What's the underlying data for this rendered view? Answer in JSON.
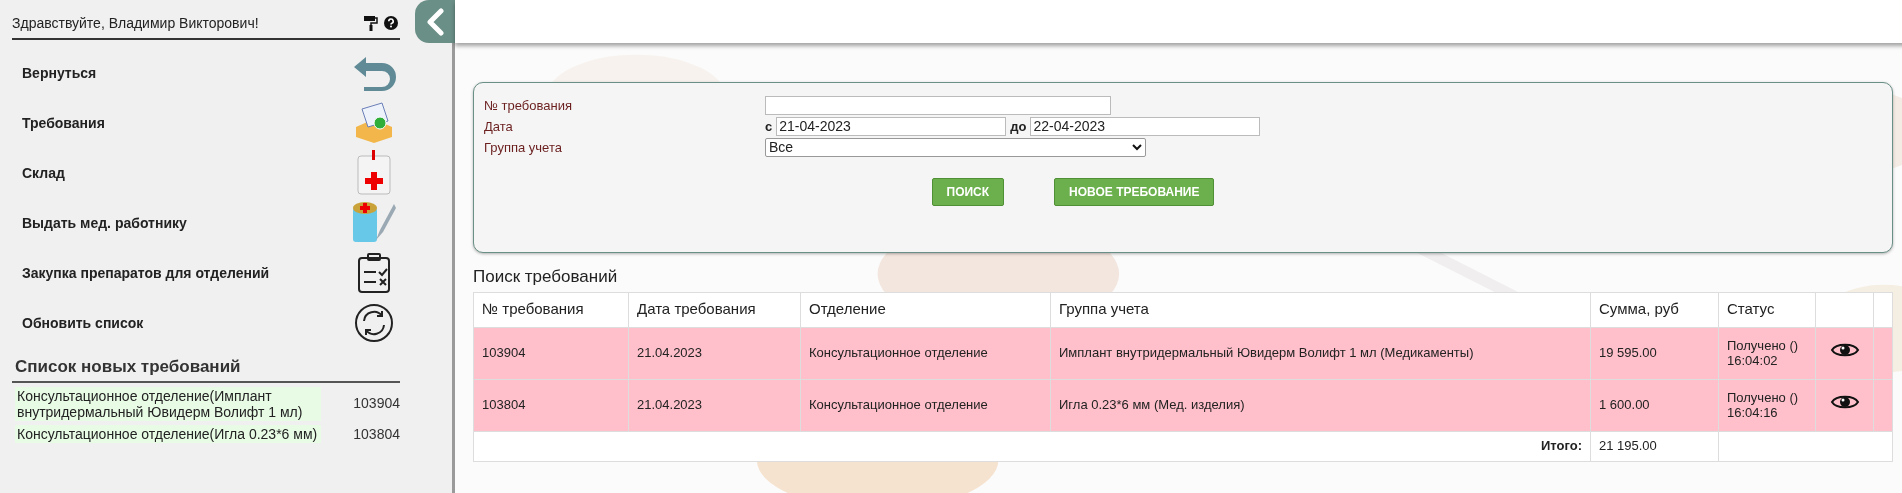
{
  "sidebar": {
    "greeting": "Здравствуйте, Владимир Викторович!",
    "menu": [
      {
        "label": "Вернуться",
        "kind": "back"
      },
      {
        "label": "Требования",
        "kind": "inbox"
      },
      {
        "label": "Склад",
        "kind": "medkit"
      },
      {
        "label": "Выдать мед. работнику",
        "kind": "syringe"
      },
      {
        "label": "Закупка препаратов для отделений",
        "kind": "checklist"
      },
      {
        "label": "Обновить список",
        "kind": "refresh"
      }
    ],
    "new_requests": {
      "title": "Список новых требований",
      "items": [
        {
          "text": "Консультационное отделение(Имплант внутридермальный Ювидерм Волифт 1 мл)",
          "number": "103904"
        },
        {
          "text": "Консультационное отделение(Игла 0.23*6 мм)",
          "number": "103804"
        }
      ]
    }
  },
  "form": {
    "number_label": "№ требования",
    "date_label": "Дата",
    "from_label": "с",
    "from_value": "21-04-2023",
    "to_label": "до",
    "to_value": "22-04-2023",
    "group_label": "Группа учета",
    "group_value": "Все",
    "buttons": [
      "ПОИСК",
      "НОВОЕ ТРЕБОВАНИЕ"
    ]
  },
  "table": {
    "title": "Поиск требований",
    "columns": [
      "№ требования",
      "Дата требования",
      "Отделение",
      "Группа учета",
      "Сумма, руб",
      "Статус"
    ],
    "rows": [
      {
        "cells": [
          "103904",
          "21.04.2023",
          "Консультационное отделение",
          "Имплант внутридермальный Ювидерм Волифт 1 мл (Медикаменты)",
          "19 595.00",
          "Получено () 16:04:02"
        ]
      },
      {
        "cells": [
          "103804",
          "21.04.2023",
          "Консультационное отделение",
          "Игла 0.23*6 мм (Мед. изделия)",
          "1 600.00",
          "Получено () 16:04:16"
        ]
      }
    ],
    "total_label": "Итого:",
    "total_value": "21 195.00"
  }
}
